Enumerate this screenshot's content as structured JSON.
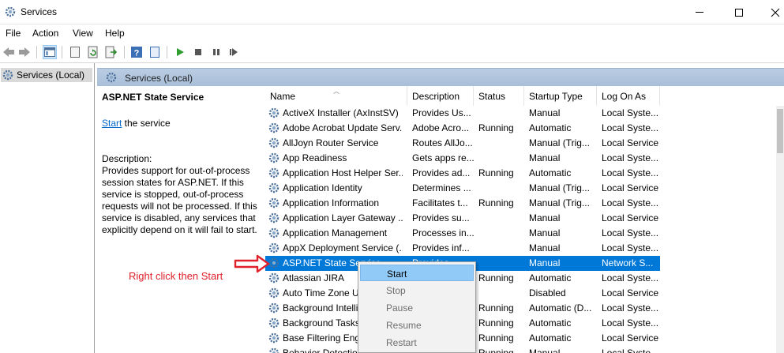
{
  "window": {
    "title": "Services"
  },
  "menu": [
    "File",
    "Action",
    "View",
    "Help"
  ],
  "tree": {
    "root_label": "Services (Local)"
  },
  "panel": {
    "title": "Services (Local)"
  },
  "details": {
    "service_title": "ASP.NET State Service",
    "start_link": "Start",
    "start_suffix": " the service",
    "description_label": "Description:",
    "description_lines": [
      "Provides support for out-of-process",
      "session states for ASP.NET. If this",
      "service is stopped, out-of-process",
      "requests will not be processed. If this",
      "service is disabled, any services that",
      "explicitly depend on it will fail to start."
    ]
  },
  "annotation": {
    "text": "Right click then Start",
    "color": "#e0212b"
  },
  "columns": [
    "Name",
    "Description",
    "Status",
    "Startup Type",
    "Log On As"
  ],
  "rows": [
    {
      "name": "ActiveX Installer (AxInstSV)",
      "description": "Provides Us...",
      "status": "",
      "startup": "Manual",
      "logon": "Local Syste..."
    },
    {
      "name": "Adobe Acrobat Update Serv...",
      "description": "Adobe Acro...",
      "status": "Running",
      "startup": "Automatic",
      "logon": "Local Syste..."
    },
    {
      "name": "AllJoyn Router Service",
      "description": "Routes AllJo...",
      "status": "",
      "startup": "Manual (Trig...",
      "logon": "Local Service"
    },
    {
      "name": "App Readiness",
      "description": "Gets apps re...",
      "status": "",
      "startup": "Manual",
      "logon": "Local Syste..."
    },
    {
      "name": "Application Host Helper Ser...",
      "description": "Provides ad...",
      "status": "Running",
      "startup": "Automatic",
      "logon": "Local Syste..."
    },
    {
      "name": "Application Identity",
      "description": "Determines ...",
      "status": "",
      "startup": "Manual (Trig...",
      "logon": "Local Service"
    },
    {
      "name": "Application Information",
      "description": "Facilitates t...",
      "status": "Running",
      "startup": "Manual (Trig...",
      "logon": "Local Syste..."
    },
    {
      "name": "Application Layer Gateway ...",
      "description": "Provides su...",
      "status": "",
      "startup": "Manual",
      "logon": "Local Service"
    },
    {
      "name": "Application Management",
      "description": "Processes in...",
      "status": "",
      "startup": "Manual",
      "logon": "Local Syste..."
    },
    {
      "name": "AppX Deployment Service (...",
      "description": "Provides inf...",
      "status": "",
      "startup": "Manual",
      "logon": "Local Syste..."
    },
    {
      "name": "ASP.NET State Service",
      "description": "Provides...",
      "status": "",
      "startup": "Manual",
      "logon": "Network S...",
      "selected": true
    },
    {
      "name": "Atlassian JIRA",
      "description": "",
      "status": "Running",
      "startup": "Automatic",
      "logon": "Local Syste..."
    },
    {
      "name": "Auto Time Zone U...",
      "description": "",
      "status": "",
      "startup": "Disabled",
      "logon": "Local Service"
    },
    {
      "name": "Background Intelli...",
      "description": "",
      "status": "Running",
      "startup": "Automatic (D...",
      "logon": "Local Syste..."
    },
    {
      "name": "Background Tasks...",
      "description": "",
      "status": "Running",
      "startup": "Automatic",
      "logon": "Local Syste..."
    },
    {
      "name": "Base Filtering Engi...",
      "description": "",
      "status": "Running",
      "startup": "Automatic",
      "logon": "Local Service"
    },
    {
      "name": "Behavior Detectio...",
      "description": "",
      "status": "Running",
      "startup": "Manual",
      "logon": "Local Syste..."
    }
  ],
  "context_menu": [
    "Start",
    "Stop",
    "Pause",
    "Resume",
    "Restart"
  ],
  "colors": {
    "selection": "#0078d7",
    "header_band": "#b9cce2",
    "link": "#0066cc"
  }
}
